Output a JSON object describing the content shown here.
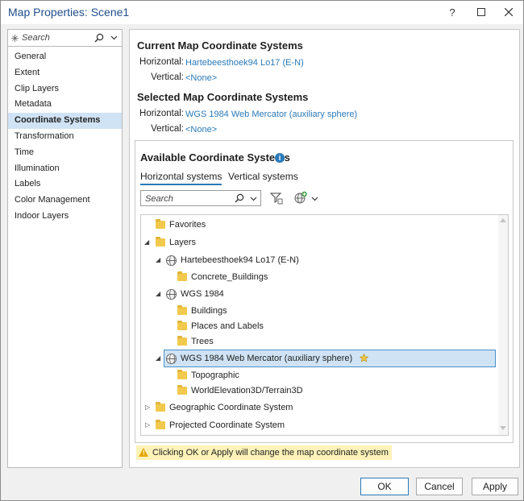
{
  "window": {
    "title": "Map Properties: Scene1"
  },
  "nav": {
    "search_placeholder": "Search",
    "items": [
      "General",
      "Extent",
      "Clip Layers",
      "Metadata",
      "Coordinate Systems",
      "Transformation",
      "Time",
      "Illumination",
      "Labels",
      "Color Management",
      "Indoor Layers"
    ],
    "selected": "Coordinate Systems"
  },
  "current": {
    "heading": "Current Map Coordinate Systems",
    "horizontal_label": "Horizontal:",
    "horizontal_value": "Hartebeesthoek94 Lo17 (E-N)",
    "vertical_label": "Vertical:",
    "vertical_value": "<None>"
  },
  "selected": {
    "heading": "Selected Map Coordinate Systems",
    "horizontal_label": "Horizontal:",
    "horizontal_value": "WGS 1984 Web Mercator (auxiliary sphere)",
    "vertical_label": "Vertical:",
    "vertical_value": "<None>"
  },
  "available": {
    "heading": "Available Coordinate Systems",
    "tabs": [
      "Horizontal systems",
      "Vertical systems"
    ],
    "active_tab": "Horizontal systems",
    "search_placeholder": "Search",
    "tree": [
      {
        "label": "Favorites",
        "level": 0,
        "icon": "favorites-folder-icon",
        "arrow": "none"
      },
      {
        "label": "Layers",
        "level": 0,
        "icon": "layers-folder-icon",
        "arrow": "expanded"
      },
      {
        "label": "Hartebeesthoek94 Lo17 (E-N)",
        "level": 1,
        "icon": "globe-icon",
        "arrow": "expanded"
      },
      {
        "label": "Concrete_Buildings",
        "level": 2,
        "icon": "layer-icon",
        "arrow": "none"
      },
      {
        "label": "WGS 1984",
        "level": 1,
        "icon": "globe-icon",
        "arrow": "expanded"
      },
      {
        "label": "Buildings",
        "level": 2,
        "icon": "layer-icon",
        "arrow": "none"
      },
      {
        "label": "Places and Labels",
        "level": 2,
        "icon": "layer-icon",
        "arrow": "none"
      },
      {
        "label": "Trees",
        "level": 2,
        "icon": "layer-icon",
        "arrow": "none"
      },
      {
        "label": "WGS 1984 Web Mercator (auxiliary sphere)",
        "level": 1,
        "icon": "globe-icon",
        "arrow": "expanded",
        "selected": true
      },
      {
        "label": "Topographic",
        "level": 2,
        "icon": "layer-icon",
        "arrow": "none"
      },
      {
        "label": "WorldElevation3D/Terrain3D",
        "level": 2,
        "icon": "layer-icon",
        "arrow": "none"
      },
      {
        "label": "Geographic Coordinate System",
        "level": 0,
        "icon": "folder-icon",
        "arrow": "collapsed"
      },
      {
        "label": "Projected Coordinate System",
        "level": 0,
        "icon": "folder-icon",
        "arrow": "collapsed"
      }
    ]
  },
  "warning": {
    "text": "Clicking OK or Apply will change the map coordinate system"
  },
  "buttons": {
    "ok": "OK",
    "cancel": "Cancel",
    "apply": "Apply"
  },
  "colors": {
    "accent": "#2a7ab8",
    "selection": "#cfe3f4",
    "warning_bg": "#fdf2b8"
  }
}
